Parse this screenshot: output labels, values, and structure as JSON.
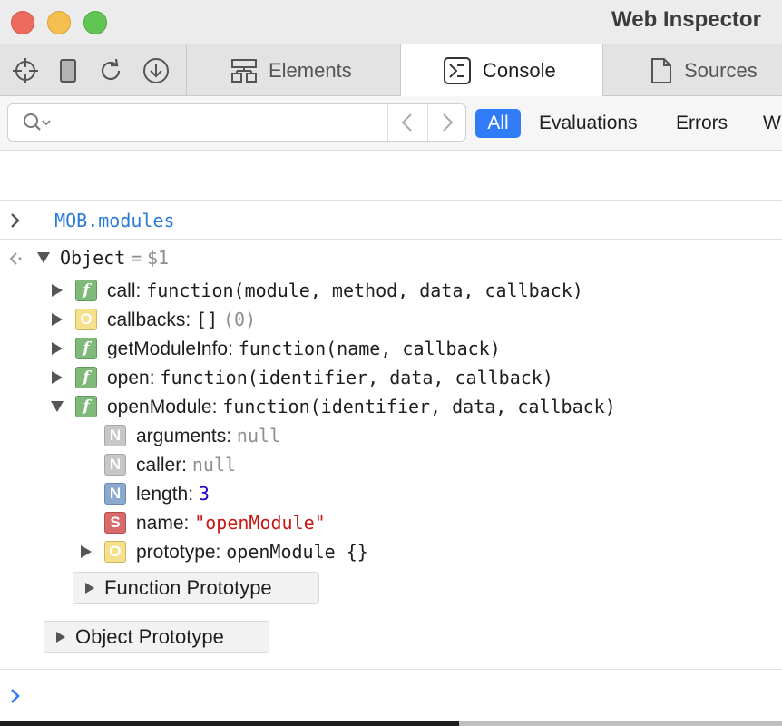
{
  "window": {
    "title": "Web Inspector"
  },
  "toolbar": {
    "icons": [
      "target-icon",
      "device-icon",
      "reload-icon",
      "download-icon"
    ]
  },
  "tabs": [
    {
      "label": "Elements",
      "icon": "elements-icon",
      "active": false
    },
    {
      "label": "Console",
      "icon": "console-icon",
      "active": true
    },
    {
      "label": "Sources",
      "icon": "document-icon",
      "active": false
    }
  ],
  "filter": {
    "search_placeholder": "",
    "buttons": [
      "All",
      "Evaluations",
      "Errors",
      "W"
    ],
    "active": "All",
    "accent_color": "#2f7cf6"
  },
  "console": {
    "command": "__MOB.modules",
    "result": {
      "label": "Object",
      "equals": "=",
      "ref": "$1",
      "properties": [
        {
          "badge": "f",
          "name": "call:",
          "value": "function(module, method, data, callback)",
          "expanded": false
        },
        {
          "badge": "O",
          "name": "callbacks:",
          "value": "[]",
          "extra": "(0)",
          "expanded": false
        },
        {
          "badge": "f",
          "name": "getModuleInfo:",
          "value": "function(name, callback)",
          "expanded": false
        },
        {
          "badge": "f",
          "name": "open:",
          "value": "function(identifier, data, callback)",
          "expanded": false
        },
        {
          "badge": "f",
          "name": "openModule:",
          "value": "function(identifier, data, callback)",
          "expanded": true
        }
      ],
      "openModule_children": [
        {
          "badge": "N",
          "name": "arguments:",
          "value": "null"
        },
        {
          "badge": "N",
          "name": "caller:",
          "value": "null"
        },
        {
          "badge": "N",
          "name": "length:",
          "value": "3"
        },
        {
          "badge": "S",
          "name": "name:",
          "value": "\"openModule\""
        },
        {
          "badge": "O",
          "name": "prototype:",
          "value": "openModule {}"
        }
      ],
      "function_prototype": "Function Prototype",
      "object_prototype": "Object Prototype"
    }
  }
}
